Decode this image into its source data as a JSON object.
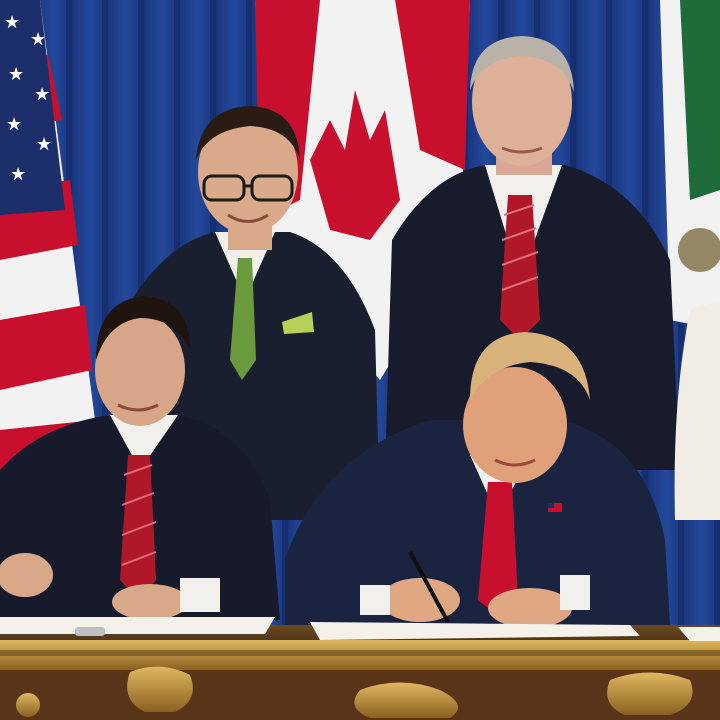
{
  "photo": {
    "subject": "signing-ceremony",
    "palette": {
      "curtain": "#1f3f8a",
      "curtain_dark": "#0f2458",
      "flag_red": "#c8102e",
      "flag_white": "#f2f2f2",
      "flag_blue": "#1c2f6b",
      "mexico_green": "#1f6b3a",
      "suit_dark": "#14182a",
      "suit_navy": "#1a2340",
      "skin": "#e0b094",
      "hair_dark": "#2a1c14",
      "hair_grey": "#b9b2a8",
      "hair_blond": "#d8b27a",
      "tie_red": "#b0182a",
      "tie_green": "#6a9a3c",
      "table_top": "#2a1a12",
      "table_gold": "#b8893a",
      "paper": "#f4f1ea"
    }
  }
}
